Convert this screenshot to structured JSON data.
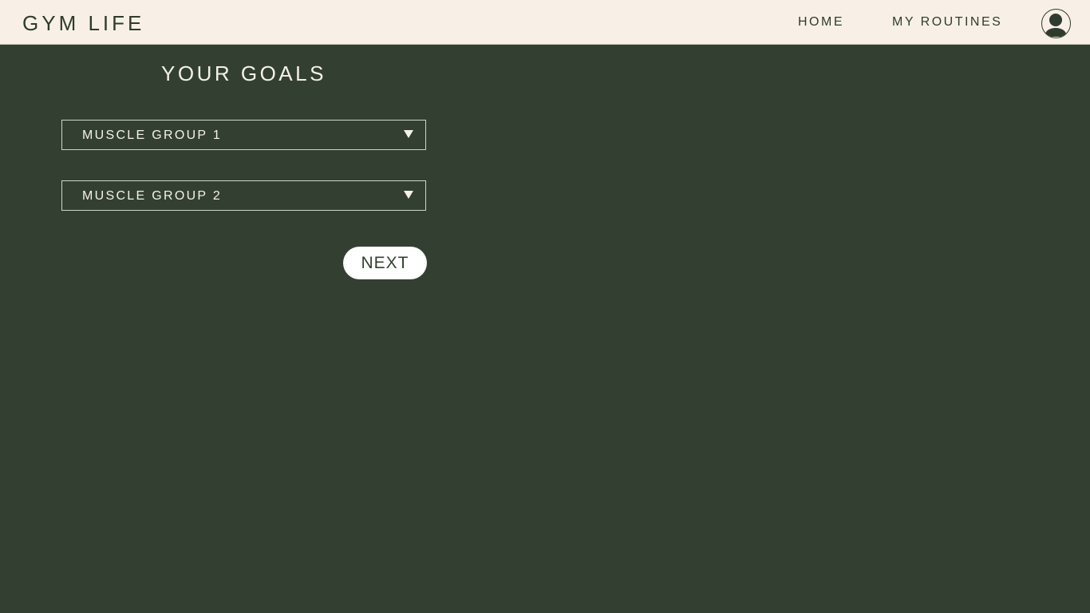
{
  "header": {
    "brand": "GYM LIFE",
    "nav": [
      {
        "label": "HOME"
      },
      {
        "label": "MY ROUTINES"
      }
    ],
    "avatar_icon": "user-avatar-icon"
  },
  "main": {
    "title": "YOUR GOALS",
    "selects": [
      {
        "value": "MUSCLE GROUP 1",
        "icon": "dropdown-arrow-icon"
      },
      {
        "value": "MUSCLE GROUP 2",
        "icon": "dropdown-arrow-icon"
      }
    ],
    "next_label": "NEXT"
  },
  "colors": {
    "background": "#334031",
    "header_bg": "#f8f0e7",
    "text_dark": "#2f3b2e",
    "text_light": "#f5f1ea",
    "button_bg": "#ffffff"
  }
}
